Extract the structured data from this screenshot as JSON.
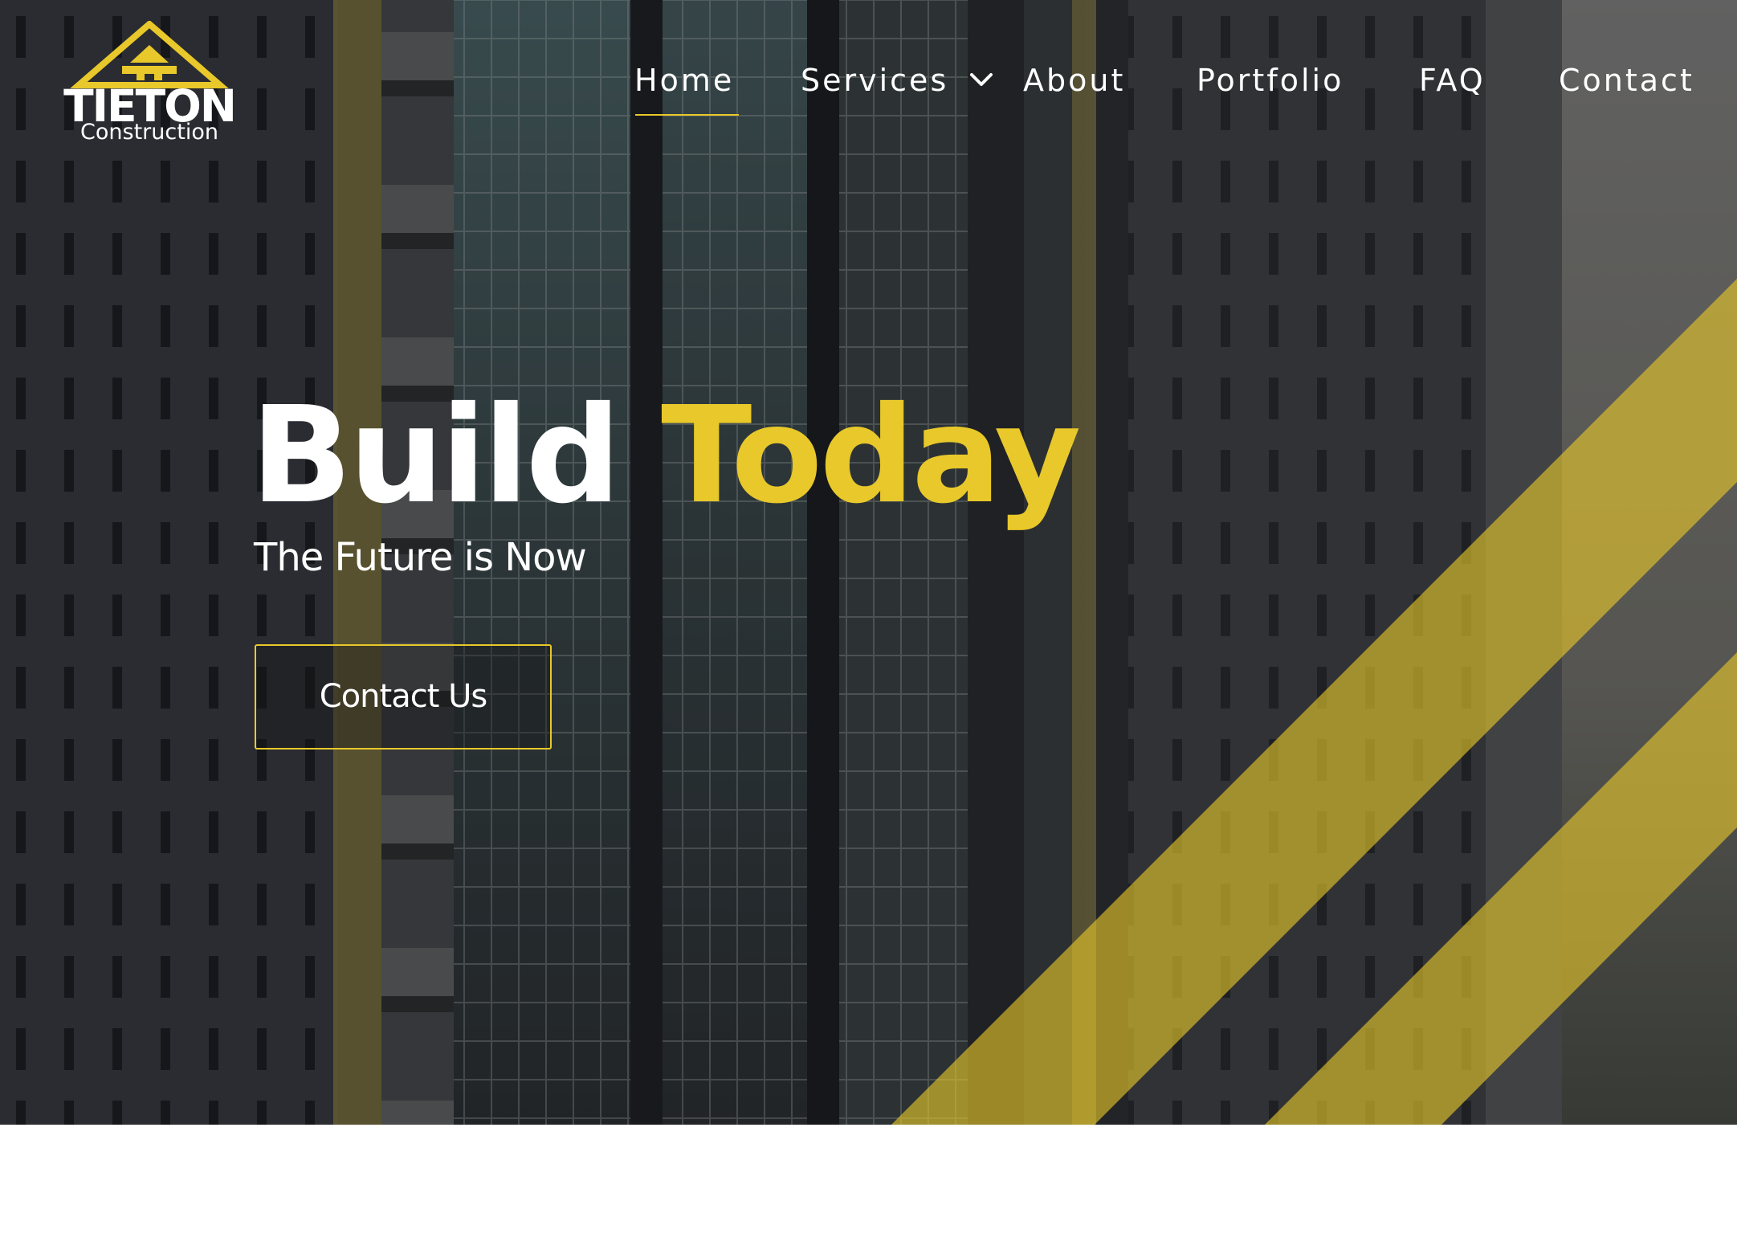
{
  "brand": {
    "name": "TIETON",
    "subtitle": "Construction"
  },
  "nav": {
    "items": [
      {
        "label": "Home",
        "active": true
      },
      {
        "label": "Services",
        "has_dropdown": true
      },
      {
        "label": "About"
      },
      {
        "label": "Portfolio"
      },
      {
        "label": "FAQ"
      },
      {
        "label": "Contact"
      }
    ]
  },
  "hero": {
    "headline_part1": "Build",
    "headline_part2": "Today",
    "subheading": "The Future is Now",
    "cta_label": "Contact Us",
    "background": "skyscraper-photo"
  },
  "colors": {
    "accent": "#e8c82a",
    "text": "#ffffff",
    "page_background": "#ffffff"
  },
  "icons": {
    "logo": "roof-triangle-logo-icon",
    "dropdown": "chevron-down-icon"
  }
}
